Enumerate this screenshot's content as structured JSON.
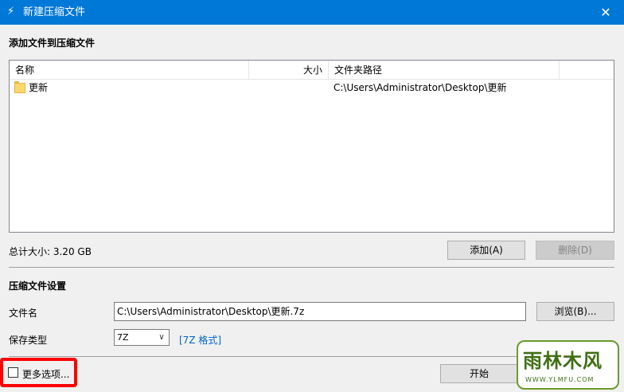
{
  "window": {
    "title": "新建压缩文件",
    "close_glyph": "✕",
    "app_icon_glyph": "⚡"
  },
  "add_section": {
    "title": "添加文件到压缩文件",
    "columns": [
      "名称",
      "大小",
      "文件夹路径",
      ""
    ],
    "rows": [
      {
        "name": "更新",
        "size": "",
        "path": "C:\\Users\\Administrator\\Desktop\\更新",
        "icon": "folder-icon"
      }
    ],
    "total_size": "总计大小: 3.20 GB",
    "add_button": "添加(A)",
    "delete_button": "删除(D)"
  },
  "settings_section": {
    "title": "压缩文件设置",
    "filename_label": "文件名",
    "filename_value": "C:\\Users\\Administrator\\Desktop\\更新.7z",
    "browse_button": "浏览(B)...",
    "type_label": "保存类型",
    "type_value": "7Z",
    "format_link": "[7Z 格式]"
  },
  "footer": {
    "more_options_label": "更多选项...",
    "start_button": "开始"
  },
  "watermark": {
    "text": "雨林木风",
    "url": "WWW.YLMFU.COM"
  },
  "colors": {
    "titlebar": "#0078d7",
    "highlight_box": "#ff0000",
    "link": "#0066cc"
  }
}
